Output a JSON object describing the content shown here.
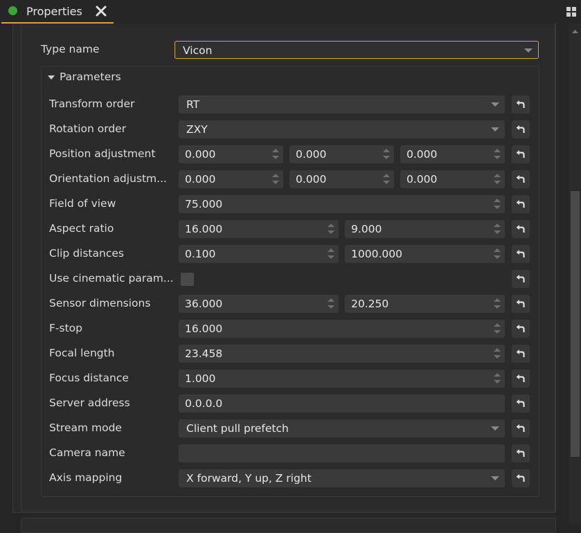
{
  "tab": {
    "title": "Properties",
    "dot_color": "#3aa635",
    "icons": [
      "close-icon",
      "layout-icon"
    ]
  },
  "type_name": {
    "label": "Type name",
    "value": "Vicon"
  },
  "parameters": {
    "header": "Parameters",
    "rows": [
      {
        "label": "Transform order",
        "kind": "combo",
        "values": [
          "RT"
        ]
      },
      {
        "label": "Rotation order",
        "kind": "combo",
        "values": [
          "ZXY"
        ]
      },
      {
        "label": "Position adjustment",
        "kind": "spin3",
        "values": [
          "0.000",
          "0.000",
          "0.000"
        ]
      },
      {
        "label": "Orientation adjustm...",
        "kind": "spin3",
        "values": [
          "0.000",
          "0.000",
          "0.000"
        ]
      },
      {
        "label": "Field of view",
        "kind": "spin1",
        "values": [
          "75.000"
        ]
      },
      {
        "label": "Aspect ratio",
        "kind": "spin2",
        "values": [
          "16.000",
          "9.000"
        ]
      },
      {
        "label": "Clip distances",
        "kind": "spin2",
        "values": [
          "0.100",
          "1000.000"
        ]
      },
      {
        "label": "Use cinematic param...",
        "kind": "check",
        "values": []
      },
      {
        "label": "Sensor dimensions",
        "kind": "spin2",
        "values": [
          "36.000",
          "20.250"
        ]
      },
      {
        "label": "F-stop",
        "kind": "spin1",
        "values": [
          "16.000"
        ]
      },
      {
        "label": "Focal length",
        "kind": "spin1",
        "values": [
          "23.458"
        ]
      },
      {
        "label": "Focus distance",
        "kind": "spin1",
        "values": [
          "1.000"
        ]
      },
      {
        "label": "Server address",
        "kind": "text",
        "values": [
          "0.0.0.0"
        ]
      },
      {
        "label": "Stream mode",
        "kind": "combo",
        "values": [
          "Client pull prefetch"
        ]
      },
      {
        "label": "Camera name",
        "kind": "text",
        "values": [
          ""
        ]
      },
      {
        "label": "Axis mapping",
        "kind": "combo",
        "values": [
          "X forward, Y up, Z right"
        ]
      }
    ]
  },
  "colors": {
    "accent": "#d9a43c",
    "background": "#262626",
    "field": "#3a3a3a"
  }
}
